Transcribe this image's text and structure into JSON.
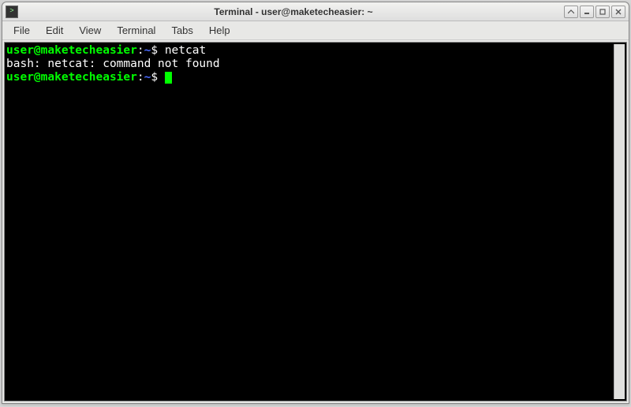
{
  "window": {
    "title": "Terminal - user@maketecheasier: ~"
  },
  "menubar": {
    "items": [
      "File",
      "Edit",
      "View",
      "Terminal",
      "Tabs",
      "Help"
    ]
  },
  "terminal": {
    "lines": [
      {
        "prompt": {
          "userhost": "user@maketecheasier",
          "path": "~",
          "symbol": "$"
        },
        "command": "netcat"
      },
      {
        "output": "bash: netcat: command not found"
      },
      {
        "prompt": {
          "userhost": "user@maketecheasier",
          "path": "~",
          "symbol": "$"
        },
        "command": "",
        "cursor": true
      }
    ]
  }
}
